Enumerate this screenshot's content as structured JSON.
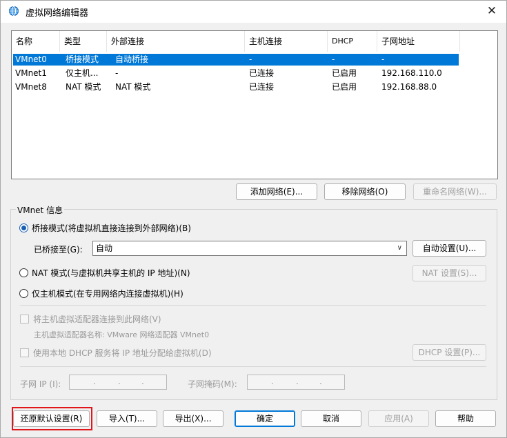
{
  "window": {
    "title": "虚拟网络编辑器",
    "close_symbol": "✕"
  },
  "list": {
    "columns": [
      "名称",
      "类型",
      "外部连接",
      "主机连接",
      "DHCP",
      "子网地址"
    ],
    "rows": [
      {
        "name": "VMnet0",
        "type": "桥接模式",
        "external": "自动桥接",
        "host": "-",
        "dhcp": "-",
        "subnet": "-",
        "selected": true
      },
      {
        "name": "VMnet1",
        "type": "仅主机...",
        "external": "-",
        "host": "已连接",
        "dhcp": "已启用",
        "subnet": "192.168.110.0",
        "selected": false
      },
      {
        "name": "VMnet8",
        "type": "NAT 模式",
        "external": "NAT 模式",
        "host": "已连接",
        "dhcp": "已启用",
        "subnet": "192.168.88.0",
        "selected": false
      }
    ]
  },
  "list_buttons": {
    "add": "添加网络(E)...",
    "remove": "移除网络(O)",
    "rename": "重命名网络(W)..."
  },
  "vmnet_info": {
    "title": "VMnet 信息",
    "bridged_label": "桥接模式(将虚拟机直接连接到外部网络)(B)",
    "bridged_to_label": "已桥接至(G):",
    "bridged_to_value": "自动",
    "auto_settings": "自动设置(U)...",
    "nat_label": "NAT 模式(与虚拟机共享主机的 IP 地址)(N)",
    "nat_settings": "NAT 设置(S)...",
    "hostonly_label": "仅主机模式(在专用网络内连接虚拟机)(H)",
    "connect_adapter_label": "将主机虚拟适配器连接到此网络(V)",
    "adapter_name_label": "主机虚拟适配器名称: VMware 网络适配器 VMnet0",
    "dhcp_label": "使用本地 DHCP 服务将 IP 地址分配给虚拟机(D)",
    "dhcp_settings": "DHCP 设置(P)...",
    "subnet_ip_label": "子网 IP (I):",
    "subnet_mask_label": "子网掩码(M):"
  },
  "footer": {
    "restore": "还原默认设置(R)",
    "import": "导入(T)...",
    "export": "导出(X)...",
    "ok": "确定",
    "cancel": "取消",
    "apply": "应用(A)",
    "help": "帮助"
  },
  "colors": {
    "selection": "#0078d7",
    "highlight": "#e0161c"
  }
}
